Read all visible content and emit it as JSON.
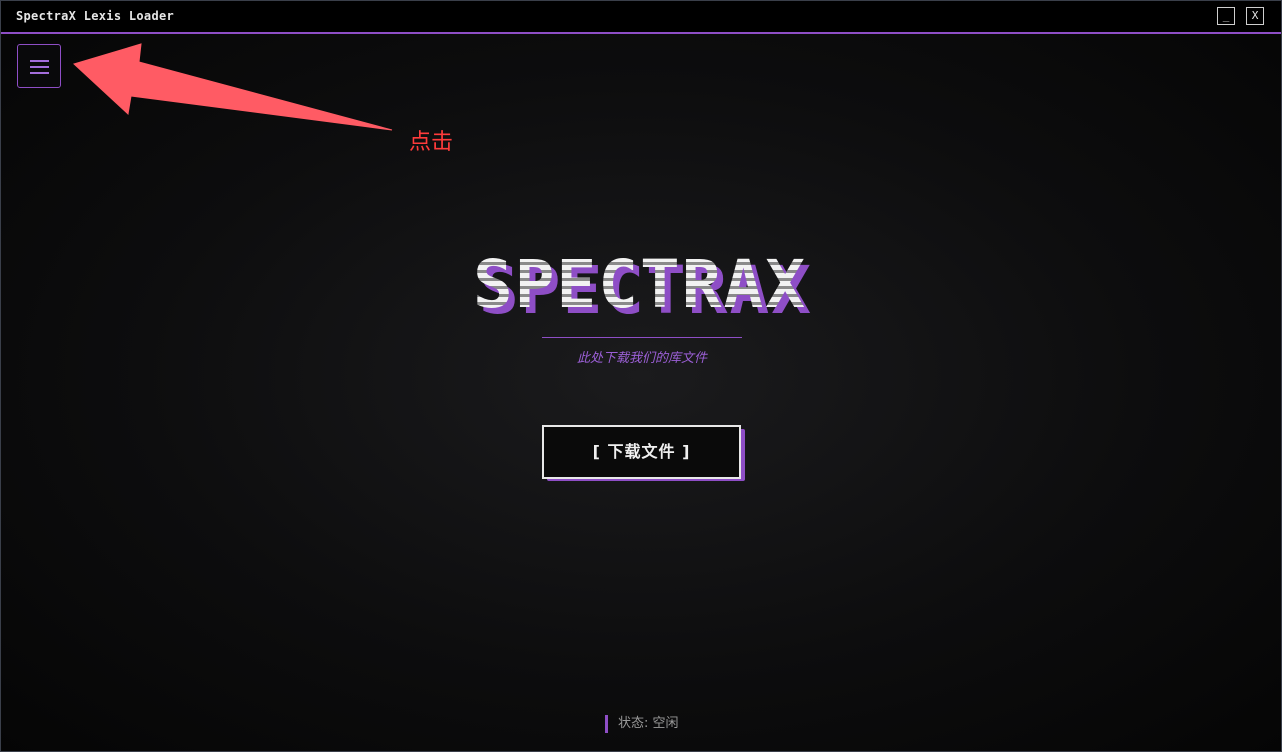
{
  "window": {
    "title": "SpectraX Lexis Loader",
    "minimize_label": "_",
    "close_label": "X"
  },
  "menu": {
    "icon": "hamburger-menu-icon"
  },
  "annotation": {
    "text": "点击",
    "color": "#ff3b3b"
  },
  "hero": {
    "logo_text": "SPECTRAX",
    "subtitle": "此处下载我们的库文件"
  },
  "download": {
    "label": "[  下载文件  ]"
  },
  "status": {
    "text": "状态: 空闲"
  },
  "colors": {
    "accent": "#8e4ec6",
    "background": "#0a0a0a",
    "text": "#e6e6e6"
  }
}
